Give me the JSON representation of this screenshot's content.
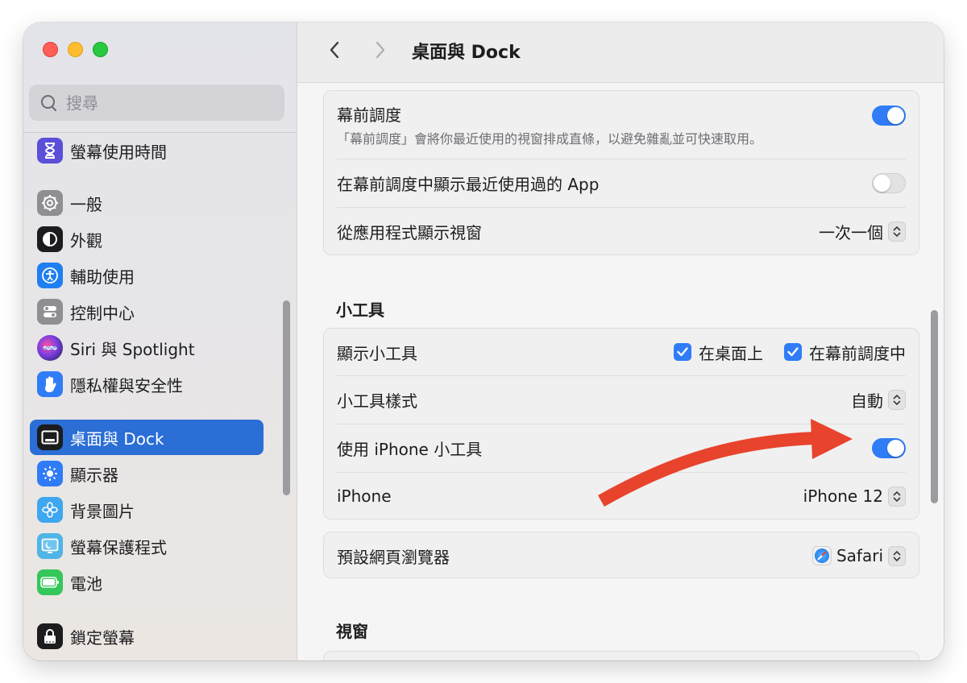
{
  "window": {
    "traffic_lights": [
      "close",
      "minimize",
      "zoom"
    ]
  },
  "sidebar": {
    "search_placeholder": "搜尋",
    "items": [
      {
        "label": "螢幕使用時間",
        "icon": "hourglass-icon",
        "color": "#5b4fd8"
      },
      {
        "label": "一般",
        "icon": "gear-icon",
        "color": "#8e8e93"
      },
      {
        "label": "外觀",
        "icon": "appearance-icon",
        "color": "#1c1c1e"
      },
      {
        "label": "輔助使用",
        "icon": "accessibility-icon",
        "color": "#1f7ef2"
      },
      {
        "label": "控制中心",
        "icon": "control-center-icon",
        "color": "#8e8e93"
      },
      {
        "label": "Siri 與 Spotlight",
        "icon": "siri-icon",
        "color": "#6b3fc7"
      },
      {
        "label": "隱私權與安全性",
        "icon": "hand-icon",
        "color": "#2f7cf6"
      },
      {
        "label": "桌面與 Dock",
        "icon": "desktop-dock-icon",
        "color": "#1c1c1e"
      },
      {
        "label": "顯示器",
        "icon": "display-icon",
        "color": "#2f7cf6"
      },
      {
        "label": "背景圖片",
        "icon": "wallpaper-icon",
        "color": "#3ea7f0"
      },
      {
        "label": "螢幕保護程式",
        "icon": "screensaver-icon",
        "color": "#4fb4e6"
      },
      {
        "label": "電池",
        "icon": "battery-icon",
        "color": "#34c759"
      },
      {
        "label": "鎖定螢幕",
        "icon": "lock-icon",
        "color": "#1c1c1e"
      }
    ],
    "active_index": 7
  },
  "main": {
    "title": "桌面與 Dock",
    "stage_manager": {
      "label": "幕前調度",
      "description": "「幕前調度」會將你最近使用的視窗排成直條，以避免雜亂並可快速取用。",
      "enabled": true,
      "show_recent_label": "在幕前調度中顯示最近使用過的 App",
      "show_recent_enabled": false,
      "show_windows_label": "從應用程式顯示視窗",
      "show_windows_value": "一次一個"
    },
    "widgets_section": {
      "title": "小工具",
      "show_widgets_label": "顯示小工具",
      "on_desktop_label": "在桌面上",
      "on_desktop_checked": true,
      "in_stage_manager_label": "在幕前調度中",
      "in_stage_manager_checked": true,
      "style_label": "小工具樣式",
      "style_value": "自動",
      "iphone_widgets_label": "使用 iPhone 小工具",
      "iphone_widgets_enabled": true,
      "iphone_label": "iPhone",
      "iphone_value": "iPhone 12"
    },
    "browser": {
      "label": "預設網頁瀏覽器",
      "value": "Safari",
      "icon": "safari-icon"
    },
    "windows_section": {
      "title": "視窗"
    }
  },
  "colors": {
    "accent": "#2f7cf6",
    "sidebar_active": "#2a6ed6",
    "annotation_arrow": "#e8432d"
  }
}
